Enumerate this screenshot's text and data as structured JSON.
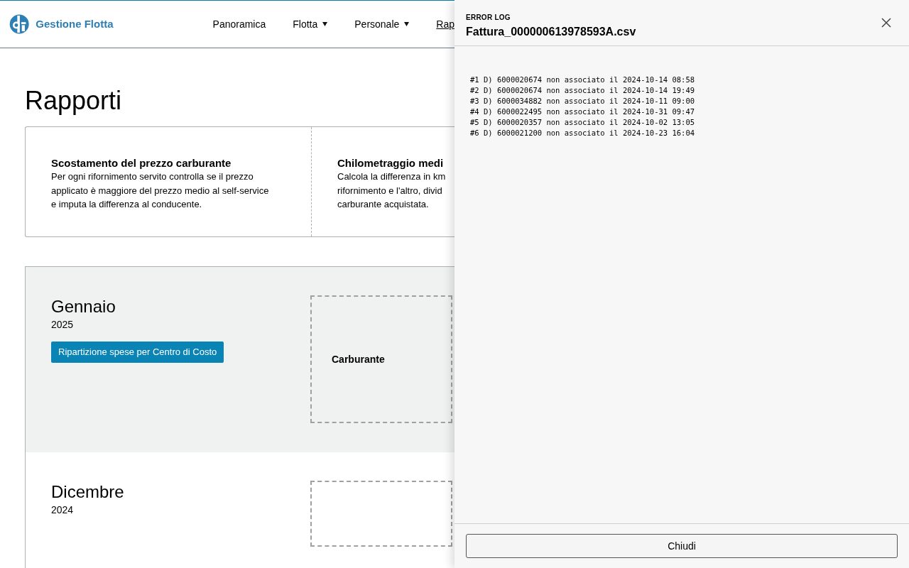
{
  "app": {
    "name": "Gestione Flotta"
  },
  "nav": [
    {
      "label": "Panoramica",
      "dropdown": false,
      "selected": false
    },
    {
      "label": "Flotta",
      "dropdown": true,
      "selected": false
    },
    {
      "label": "Personale",
      "dropdown": true,
      "selected": false
    },
    {
      "label": "Rap",
      "dropdown": false,
      "selected": true
    }
  ],
  "page_title": "Rapporti",
  "report_cards": [
    {
      "title": "Scostamento del prezzo carburante",
      "description_lines": [
        "Per ogni rifornimento servito controlla se il prezzo",
        "applicato è maggiore del prezzo medio al self-service",
        "e imputa la differenza al conducente."
      ]
    },
    {
      "title": "Chilometraggio medi",
      "description_lines": [
        "Calcola la differenza in km",
        "rifornimento e l'altro, divid",
        "carburante acquistata."
      ]
    }
  ],
  "months": [
    {
      "month": "Gennaio",
      "year": "2025",
      "highlighted": true,
      "button": "Ripartizione spese per Centro di Costo",
      "tile_label": "Carburante"
    },
    {
      "month": "Dicembre",
      "year": "2024",
      "highlighted": false
    }
  ],
  "error_log": {
    "eyebrow": "ERROR LOG",
    "title": "Fattura_000000613978593A.csv",
    "lines": [
      "#1 D) 6000020674 non associato il 2024-10-14 08:58",
      "#2 D) 6000020674 non associato il 2024-10-14 19:49",
      "#3 D) 6000034882 non associato il 2024-10-11 09:00",
      "#4 D) 6000022495 non associato il 2024-10-31 09:47",
      "#5 D) 6000020357 non associato il 2024-10-02 13:05",
      "#6 D) 6000021200 non associato il 2024-10-23 16:04"
    ],
    "close_button": "Chiudi"
  }
}
